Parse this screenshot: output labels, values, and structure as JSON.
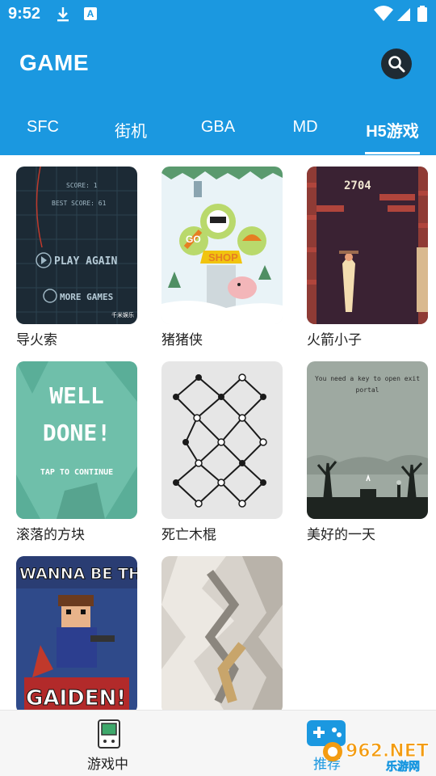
{
  "status_bar": {
    "time": "9:52",
    "a_badge": "A"
  },
  "app_bar": {
    "title": "GAME",
    "search_icon": "search-icon"
  },
  "tabs": [
    {
      "label": "SFC",
      "active": false
    },
    {
      "label": "街机",
      "active": false
    },
    {
      "label": "GBA",
      "active": false
    },
    {
      "label": "MD",
      "active": false
    },
    {
      "label": "H5游戏",
      "active": true
    }
  ],
  "games": [
    {
      "title": "导火索",
      "art": {
        "score": "SCORE: 1",
        "best": "BEST SCORE: 61",
        "play_again": "PLAY AGAIN",
        "more_games": "MORE GAMES",
        "brand": "千米娱乐"
      }
    },
    {
      "title": "猪猪侠",
      "art": {
        "go": "GO",
        "shop": "SHOP"
      }
    },
    {
      "title": "火箭小子",
      "art": {
        "score": "2704"
      }
    },
    {
      "title": "滚落的方块",
      "art": {
        "line1": "WELL",
        "line2": "DONE!",
        "line3": "TAP TO CONTINUE"
      }
    },
    {
      "title": "死亡木棍",
      "art": {}
    },
    {
      "title": "美好的一天",
      "art": {
        "line1": "You need a key to open exit",
        "line2": "portal"
      }
    },
    {
      "title": "",
      "art": {
        "line1": "WANNA BE THE GU",
        "line2": "GAIDEN!"
      }
    },
    {
      "title": "",
      "art": {}
    }
  ],
  "bottom_nav": [
    {
      "label": "游戏中",
      "icon": "gameboy-icon"
    },
    {
      "label": "推荐",
      "icon": "gamepad-icon"
    }
  ],
  "watermark": {
    "brand": "962.NET",
    "sub": "乐游网"
  },
  "colors": {
    "primary": "#1b98e0",
    "search_bg": "#1f2a33",
    "caption_text": "#222222"
  }
}
